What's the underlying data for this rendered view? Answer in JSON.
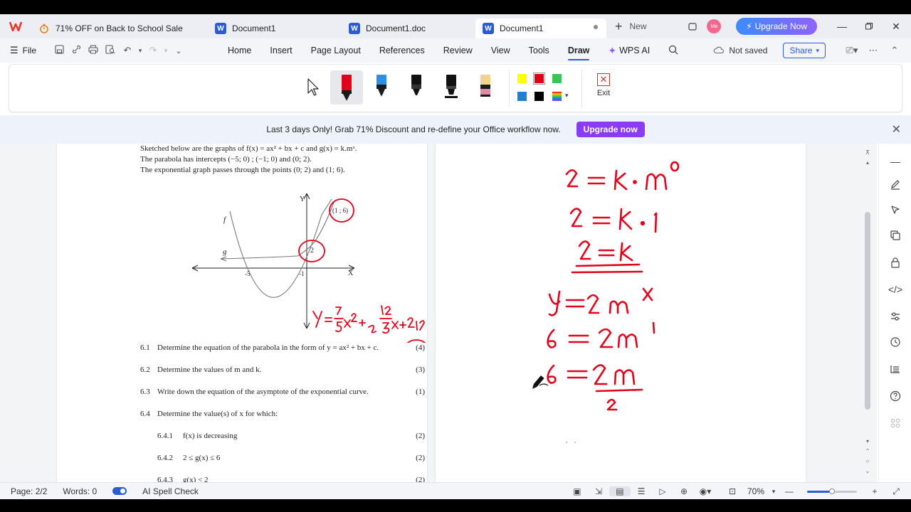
{
  "tabs": {
    "sale_label": "71% OFF on Back to School Sale",
    "doc1_label": "Document1",
    "doc2_label": "Document1.doc",
    "active_label": "Document1",
    "new_label": "New",
    "word_letter": "W",
    "avatar_text": "Ma"
  },
  "titlebar": {
    "upgrade_label": "Upgrade Now"
  },
  "menubar": {
    "file_label": "File",
    "items": [
      "Home",
      "Insert",
      "Page Layout",
      "References",
      "Review",
      "View",
      "Tools",
      "Draw"
    ],
    "wpsai_label": "WPS AI",
    "save_status": "Not saved",
    "share_label": "Share"
  },
  "ribbon": {
    "exit_label": "Exit",
    "colors": {
      "yellow": "#ffff00",
      "red": "#e0001b",
      "green": "#3cc35a",
      "blue": "#1f7fd1",
      "black": "#000000"
    }
  },
  "promo": {
    "text": "Last 3 days Only! Grab 71% Discount and re-define your Office workflow now.",
    "button_label": "Upgrade now"
  },
  "left_page": {
    "intro": [
      "Sketched below are the graphs of   f(x) = ax² + bx + c and g(x) = k.mˣ.",
      "The parabola has intercepts (−5; 0) ; (−1; 0) and (0; 2).",
      "The exponential graph passes through the points (0; 2) and (1; 6)."
    ],
    "graph_labels": {
      "y_axis": "Y",
      "x_axis": "X",
      "f": "f",
      "g": "g",
      "minus5": "-5",
      "minus1": "-1",
      "two": "2",
      "point": "(1 ; 6)"
    },
    "questions": [
      {
        "num": "6.1",
        "text": "Determine the equation of the parabola in the form of   y = ax² + bx + c.",
        "marks": "(4)"
      },
      {
        "num": "6.2",
        "text": "Determine the values of m and k.",
        "marks": "(3)"
      },
      {
        "num": "6.3",
        "text": "Write down the equation of the asymptote of the exponential curve.",
        "marks": "(1)"
      },
      {
        "num": "6.4",
        "text": "Determine the value(s) of x for which:",
        "marks": ""
      },
      {
        "num": "6.4.1",
        "text": "f(x) is decreasing",
        "marks": "(2)"
      },
      {
        "num": "6.4.2",
        "text": "2 ≤ g(x) ≤ 6",
        "marks": "(2)"
      },
      {
        "num": "6.4.3",
        "text": "g(x) < 2",
        "marks": "(2)"
      }
    ]
  },
  "handwriting": {
    "color": "#e0001b"
  },
  "statusbar": {
    "page": "Page: 2/2",
    "words": "Words: 0",
    "spell": "AI Spell Check",
    "zoom": "70%",
    "zoom_level": 0.5
  }
}
